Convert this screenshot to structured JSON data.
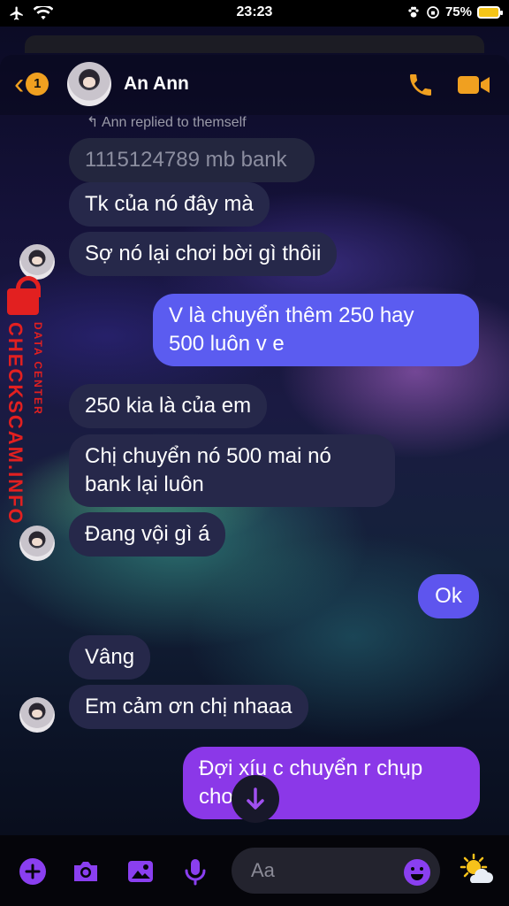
{
  "status": {
    "time": "23:23",
    "battery": "75%"
  },
  "header": {
    "back_count": "1",
    "name": "An Ann"
  },
  "reply_note": "Ann replied to themself",
  "messages": [
    {
      "text": "1115124789 mb bank"
    },
    {
      "text": "Tk của nó đây mà"
    },
    {
      "text": "Sợ nó lại chơi bời gì thôii"
    },
    {
      "text": "V là chuyển thêm 250 hay\n500 luôn v e"
    },
    {
      "text": "250 kia là của em"
    },
    {
      "text": "Chị chuyển nó 500 mai nó\nbank lại luôn"
    },
    {
      "text": "Đang vội gì á"
    },
    {
      "text": "Ok"
    },
    {
      "text": "Vâng"
    },
    {
      "text": "Em cảm ơn chị nhaaa"
    },
    {
      "text": "Đợi xíu c chuyển r chụp\ncho"
    }
  ],
  "watermark": {
    "main": "CHECKSCAM.INFO",
    "sub": "DATA CENTER"
  },
  "composer": {
    "placeholder": "Aa"
  },
  "colors": {
    "accent": "#f0a020",
    "incoming_bubble": "#26284a",
    "outgoing_blue": "#5b5cf0",
    "outgoing_purple": "#8b38e8",
    "composer_icon": "#8a3ff0",
    "watermark_red": "#e22020"
  },
  "icons": [
    "wifi-icon",
    "airplane-icon",
    "paw-icon",
    "orientation-lock-icon",
    "battery-icon",
    "chevron-left-icon",
    "phone-icon",
    "video-camera-icon",
    "reply-arrow-icon",
    "arrow-down-icon",
    "plus-icon",
    "camera-icon",
    "image-icon",
    "microphone-icon",
    "emoji-icon",
    "weather-icon"
  ]
}
